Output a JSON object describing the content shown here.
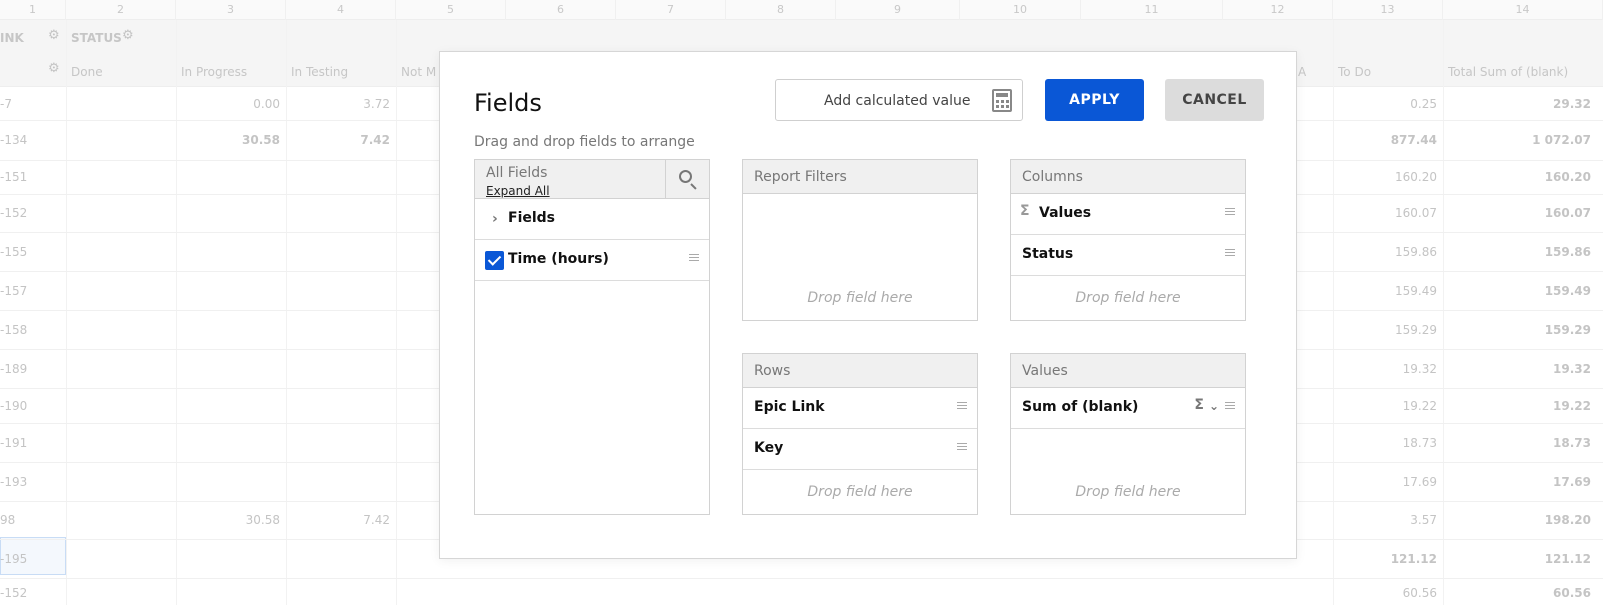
{
  "grid": {
    "column_numbers": [
      "1",
      "2",
      "3",
      "4",
      "5",
      "6",
      "7",
      "8",
      "9",
      "10",
      "11",
      "12",
      "13",
      "14"
    ],
    "status_header": {
      "left_label": "INK",
      "status_label": "STATUS"
    },
    "sub_headers": [
      "Done",
      "In Progress",
      "In Testing",
      "Not M",
      "A",
      "To Do",
      "Total Sum of (blank)"
    ],
    "rows": [
      {
        "key": "-7",
        "in_progress": "0.00",
        "in_testing": "3.72",
        "to_do": "0.25",
        "total": "29.32"
      },
      {
        "key": "-134",
        "in_progress": "30.58",
        "in_testing": "7.42",
        "to_do": "877.44",
        "total": "1 072.07"
      },
      {
        "key": "-151",
        "in_progress": "",
        "in_testing": "",
        "to_do": "160.20",
        "total": "160.20"
      },
      {
        "key": "-152",
        "in_progress": "",
        "in_testing": "",
        "to_do": "160.07",
        "total": "160.07"
      },
      {
        "key": "-155",
        "in_progress": "",
        "in_testing": "",
        "to_do": "159.86",
        "total": "159.86"
      },
      {
        "key": "-157",
        "in_progress": "",
        "in_testing": "",
        "to_do": "159.49",
        "total": "159.49"
      },
      {
        "key": "-158",
        "in_progress": "",
        "in_testing": "",
        "to_do": "159.29",
        "total": "159.29"
      },
      {
        "key": "-189",
        "in_progress": "",
        "in_testing": "",
        "to_do": "19.32",
        "total": "19.32"
      },
      {
        "key": "-190",
        "in_progress": "",
        "in_testing": "",
        "to_do": "19.22",
        "total": "19.22"
      },
      {
        "key": "-191",
        "in_progress": "",
        "in_testing": "",
        "to_do": "18.73",
        "total": "18.73"
      },
      {
        "key": "-193",
        "in_progress": "",
        "in_testing": "",
        "to_do": "17.69",
        "total": "17.69"
      },
      {
        "key": "98",
        "in_progress": "30.58",
        "in_testing": "7.42",
        "to_do": "3.57",
        "total": "198.20"
      },
      {
        "key": "-195",
        "in_progress": "",
        "in_testing": "",
        "to_do": "121.12",
        "total": "121.12"
      },
      {
        "key": "-152",
        "in_progress": "",
        "in_testing": "",
        "to_do": "60.56",
        "total": "60.56"
      }
    ]
  },
  "modal": {
    "title": "Fields",
    "subtitle": "Drag and drop fields to arrange",
    "calc_button": "Add calculated value",
    "apply": "APPLY",
    "cancel": "CANCEL",
    "all_fields": {
      "label": "All Fields",
      "expand_all": "Expand All",
      "items": [
        {
          "label": "Fields",
          "type": "group"
        },
        {
          "label": "Time (hours)",
          "type": "checked"
        }
      ]
    },
    "report_filters": {
      "label": "Report Filters",
      "drop": "Drop field here"
    },
    "columns": {
      "label": "Columns",
      "items": [
        "Values",
        "Status"
      ],
      "drop": "Drop field here"
    },
    "rows": {
      "label": "Rows",
      "items": [
        "Epic Link",
        "Key"
      ],
      "drop": "Drop field here"
    },
    "values": {
      "label": "Values",
      "items": [
        "Sum of (blank)"
      ],
      "drop": "Drop field here"
    }
  },
  "colors": {
    "accent": "#0a57d6",
    "cancel_bg": "#dcdcdc"
  }
}
